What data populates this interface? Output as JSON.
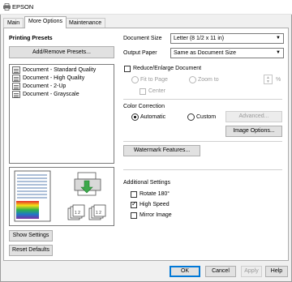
{
  "window": {
    "title": "EPSON",
    "icon": "printer-icon"
  },
  "tabs": [
    {
      "label": "Main",
      "active": false
    },
    {
      "label": "More Options",
      "active": true
    },
    {
      "label": "Maintenance",
      "active": false
    }
  ],
  "presets": {
    "heading": "Printing Presets",
    "add_remove_label": "Add/Remove Presets...",
    "items": [
      {
        "label": "Document - Standard Quality"
      },
      {
        "label": "Document - High Quality"
      },
      {
        "label": "Document - 2-Up"
      },
      {
        "label": "Document - Grayscale"
      }
    ],
    "show_settings_label": "Show Settings",
    "reset_defaults_label": "Reset Defaults"
  },
  "document_size": {
    "label": "Document Size",
    "value": "Letter (8 1/2 x 11 in)"
  },
  "output_paper": {
    "label": "Output Paper",
    "value": "Same as Document Size"
  },
  "reduce_enlarge": {
    "label": "Reduce/Enlarge Document",
    "checked": false,
    "fit_to_page_label": "Fit to Page",
    "zoom_to_label": "Zoom to",
    "center_label": "Center",
    "percent_unit": "%"
  },
  "color_correction": {
    "heading": "Color Correction",
    "automatic_label": "Automatic",
    "custom_label": "Custom",
    "selected": "Automatic",
    "advanced_label": "Advanced...",
    "image_options_label": "Image Options..."
  },
  "watermark_label": "Watermark Features...",
  "additional_settings": {
    "heading": "Additional Settings",
    "rotate_label": "Rotate 180°",
    "rotate_checked": false,
    "high_speed_label": "High Speed",
    "high_speed_checked": true,
    "mirror_label": "Mirror Image",
    "mirror_checked": false
  },
  "footer": {
    "ok_label": "OK",
    "cancel_label": "Cancel",
    "apply_label": "Apply",
    "help_label": "Help"
  }
}
